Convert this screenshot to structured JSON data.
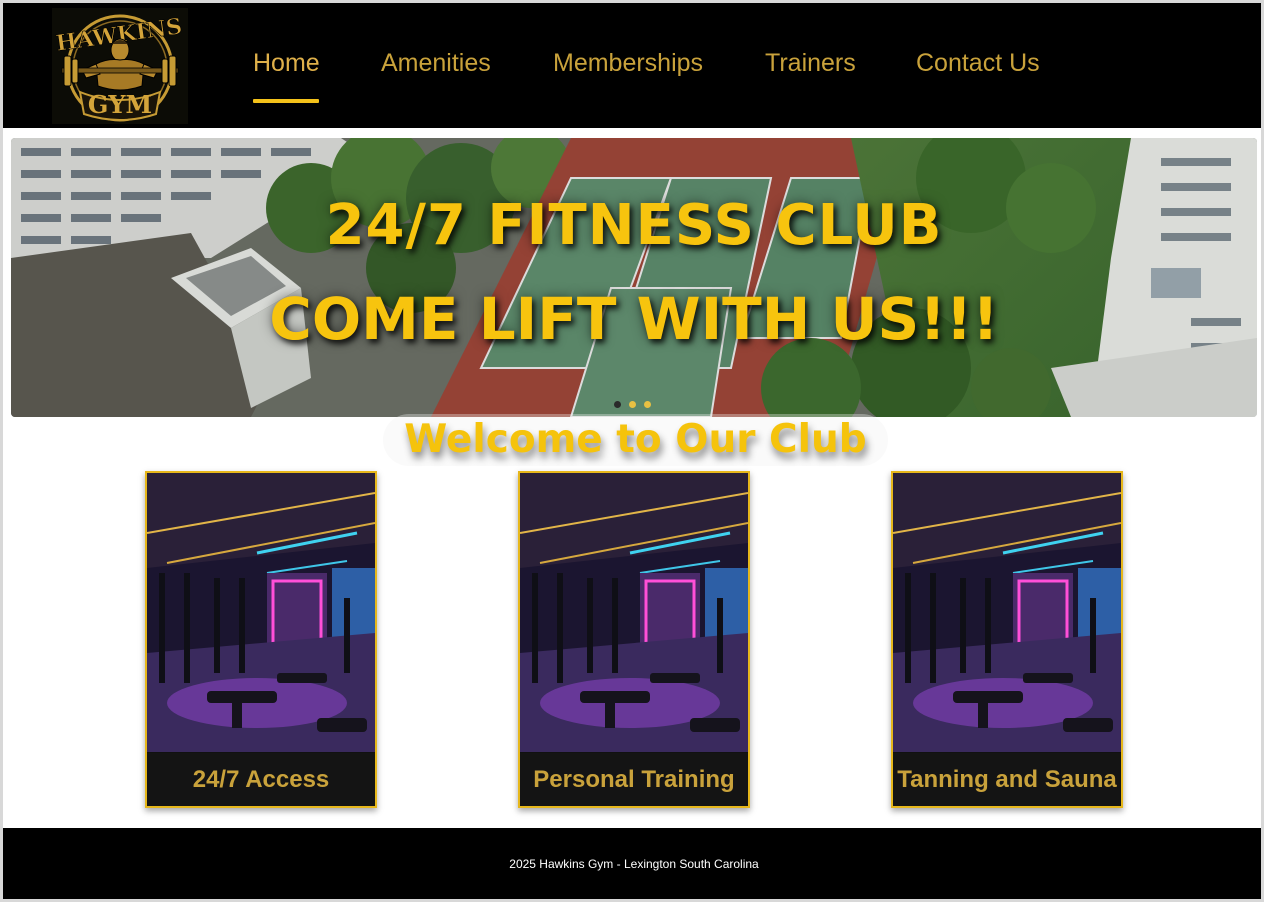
{
  "logo": {
    "text_top": "HAWKINS",
    "text_bottom": "GYM",
    "icon": "bodybuilder-barbell-logo"
  },
  "nav": {
    "items": [
      {
        "label": "Home",
        "active": true
      },
      {
        "label": "Amenities",
        "active": false
      },
      {
        "label": "Memberships",
        "active": false
      },
      {
        "label": "Trainers",
        "active": false
      },
      {
        "label": "Contact Us",
        "active": false
      }
    ]
  },
  "hero": {
    "line1": "24/7 FITNESS CLUB",
    "line2": "COME LIFT WITH US!!!",
    "image": "aerial-tennis-courts-photo",
    "slides": 3,
    "active_slide": 1
  },
  "welcome": "Welcome to Our Club",
  "cards": [
    {
      "caption": "24/7 Access",
      "image": "neon-gym-interior-photo"
    },
    {
      "caption": "Personal Training",
      "image": "neon-gym-interior-photo"
    },
    {
      "caption": "Tanning and Sauna",
      "image": "neon-gym-interior-photo"
    }
  ],
  "footer": {
    "text": "2025 Hawkins Gym - Lexington South Carolina"
  },
  "colors": {
    "gold": "#f4c21a",
    "nav_text": "#c9a23b",
    "bar": "#000000"
  }
}
